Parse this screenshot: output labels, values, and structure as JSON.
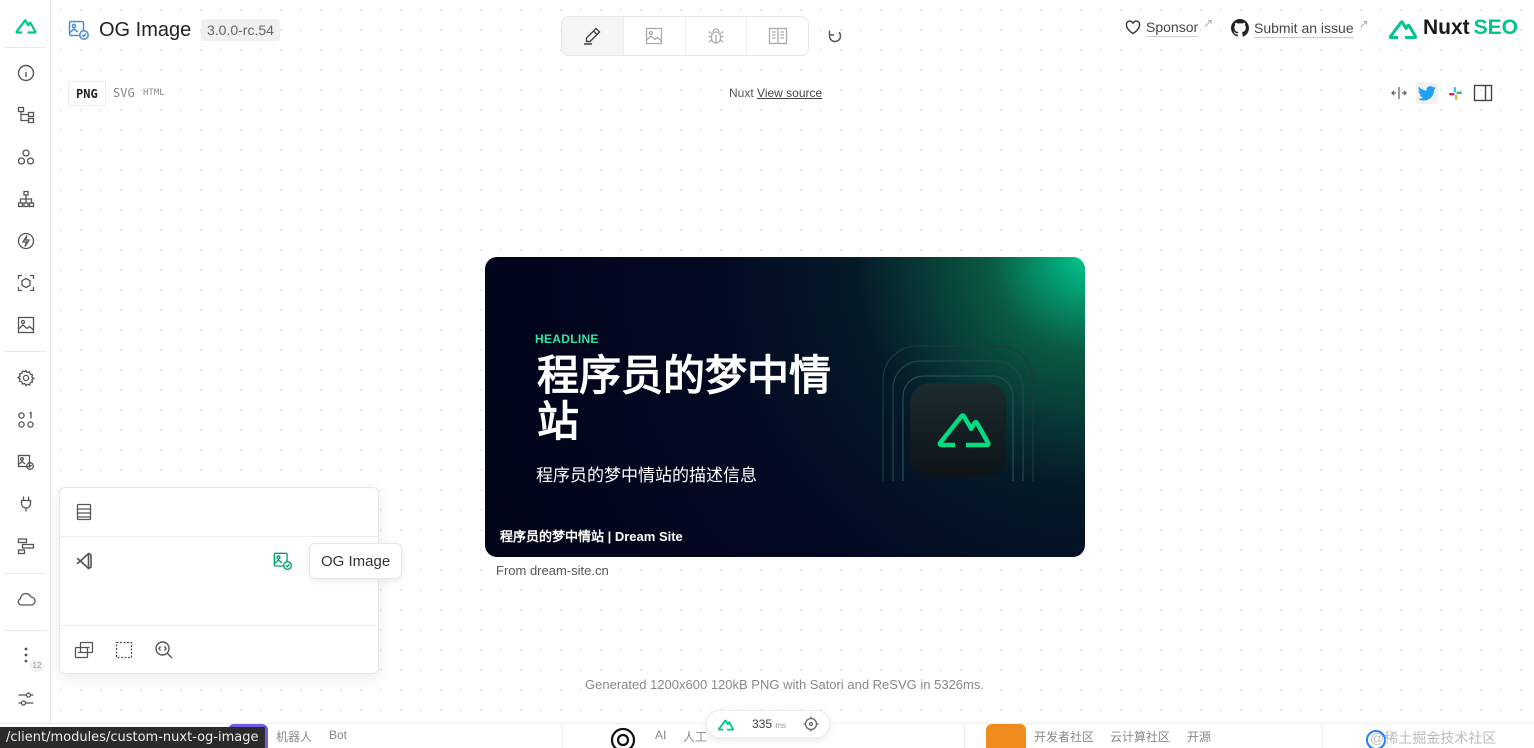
{
  "app": {
    "title": "OG Image",
    "version": "3.0.0-rc.54"
  },
  "header": {
    "sponsor": "Sponsor",
    "submit_issue": "Submit an issue",
    "brand_nuxt": "Nuxt",
    "brand_seo": "SEO"
  },
  "formats": {
    "png": "PNG",
    "svg": "SVG",
    "html": "HTML"
  },
  "source": {
    "prefix": "Nuxt",
    "link": "View source"
  },
  "og": {
    "headline": "HEADLINE",
    "title": "程序员的梦中情站",
    "description": "程序员的梦中情站的描述信息",
    "site": "程序员的梦中情站 | Dream Site"
  },
  "from": "From dream-site.cn",
  "generated": "Generated 1200x600 120kB PNG with Satori and ReSVG in 5326ms.",
  "popup": {
    "tooltip": "OG Image"
  },
  "sidebar": {
    "badge": "12"
  },
  "devbar": {
    "ms_value": "335",
    "ms_unit": "ms"
  },
  "bottom_strip": {
    "a": "机器人",
    "b": "Bot",
    "c": "AI",
    "d": "人工",
    "e": "开发者社区",
    "f": "云计算社区",
    "g": "开源",
    "h": "@稀土掘金技术社区"
  },
  "status_url": "/client/modules/custom-nuxt-og-image",
  "colors": {
    "accent": "#00c58e",
    "card_bg": "#030822"
  }
}
